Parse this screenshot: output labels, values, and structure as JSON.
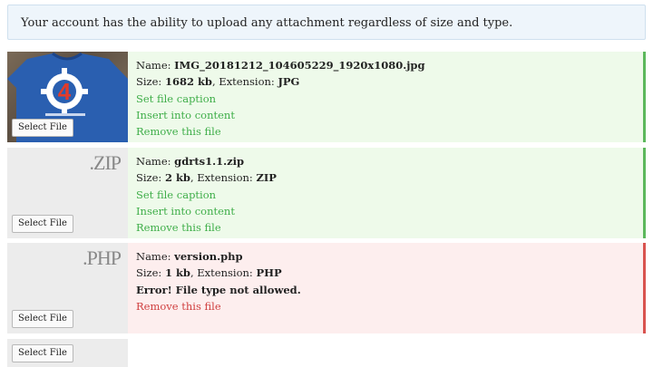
{
  "notice": "Your account has the ability to upload any attachment regardless of size and type.",
  "labels": {
    "name": "Name:",
    "size": "Size:",
    "extension": "Extension:",
    "select_file": "Select File"
  },
  "files": [
    {
      "name": "IMG_20181212_104605229_1920x1080.jpg",
      "size": "1682 kb",
      "extension": "JPG",
      "status": "ok",
      "actions": [
        "Set file caption",
        "Insert into content",
        "Remove this file"
      ]
    },
    {
      "name": "gdrts1.1.zip",
      "size": "2 kb",
      "extension": "ZIP",
      "thumb_label": ".ZIP",
      "status": "ok",
      "actions": [
        "Set file caption",
        "Insert into content",
        "Remove this file"
      ]
    },
    {
      "name": "version.php",
      "size": "1 kb",
      "extension": "PHP",
      "thumb_label": ".PHP",
      "status": "error",
      "error": "Error! File type not allowed.",
      "actions": [
        "Remove this file"
      ]
    }
  ],
  "colors": {
    "ok_accent": "#5cb85c",
    "error_accent": "#d9534f",
    "link_ok": "#3fae49",
    "link_error": "#d04040"
  }
}
